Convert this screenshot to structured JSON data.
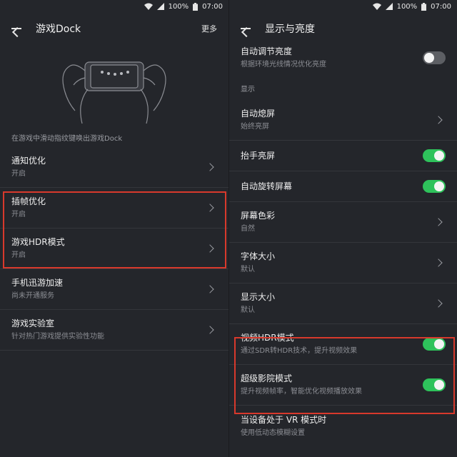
{
  "status": {
    "battery": "100%",
    "time": "07:00"
  },
  "left": {
    "header": {
      "title": "游戏Dock",
      "action": "更多"
    },
    "hint": "在游戏中滑动指纹键唤出游戏Dock",
    "items": [
      {
        "title": "通知优化",
        "subtitle": "开启"
      },
      {
        "title": "插帧优化",
        "subtitle": "开启"
      },
      {
        "title": "游戏HDR模式",
        "subtitle": "开启"
      },
      {
        "title": "手机迅游加速",
        "subtitle": "尚未开通服务"
      },
      {
        "title": "游戏实验室",
        "subtitle": "针对热门游戏提供实验性功能"
      }
    ]
  },
  "right": {
    "header": {
      "title": "显示与亮度"
    },
    "top_item": {
      "title": "自动调节亮度",
      "subtitle": "根据环境光线情况优化亮度",
      "toggle": false
    },
    "section_label": "显示",
    "items": [
      {
        "title": "自动熄屏",
        "subtitle": "始终亮屏",
        "control": "chevron"
      },
      {
        "title": "抬手亮屏",
        "subtitle": "",
        "control": "toggle",
        "on": true
      },
      {
        "title": "自动旋转屏幕",
        "subtitle": "",
        "control": "toggle",
        "on": true
      },
      {
        "title": "屏幕色彩",
        "subtitle": "自然",
        "control": "chevron"
      },
      {
        "title": "字体大小",
        "subtitle": "默认",
        "control": "chevron"
      },
      {
        "title": "显示大小",
        "subtitle": "默认",
        "control": "chevron"
      },
      {
        "title": "视频HDR模式",
        "subtitle": "通过SDR转HDR技术，提升视频效果",
        "control": "toggle",
        "on": true
      },
      {
        "title": "超级影院模式",
        "subtitle": "提升视频帧率，智能优化视频播放效果",
        "control": "toggle",
        "on": true
      },
      {
        "title": "当设备处于 VR 模式时",
        "subtitle": "使用低动态模糊设置",
        "control": "none"
      }
    ]
  },
  "colors": {
    "toggle_on": "#2ec25b",
    "highlight": "#d8392c",
    "background": "#24262b"
  }
}
